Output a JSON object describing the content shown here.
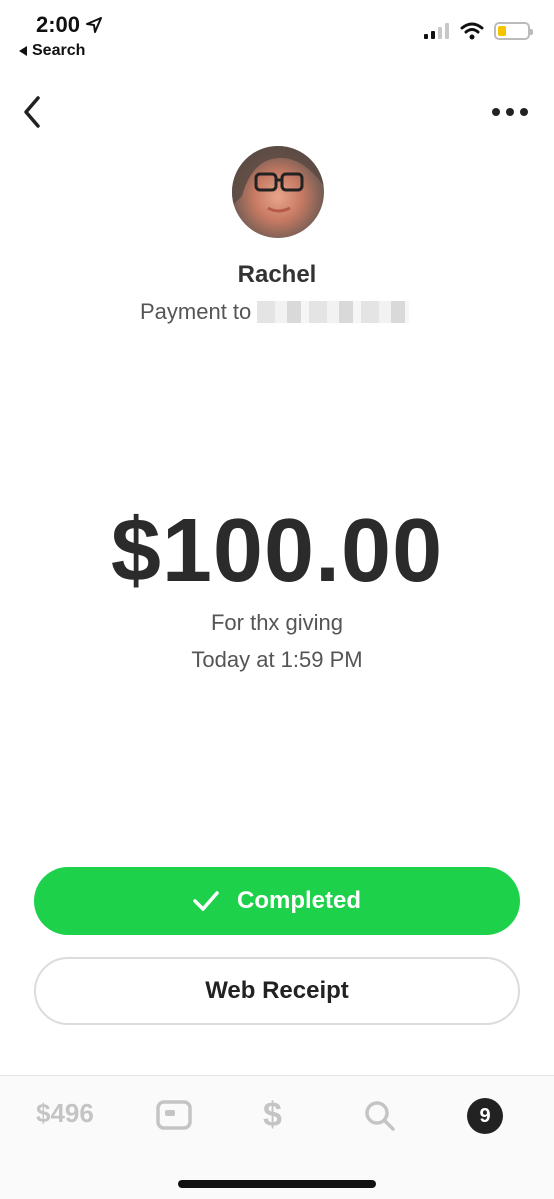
{
  "status_bar": {
    "time": "2:00",
    "back_app": "Search"
  },
  "header": {
    "back_icon": "chevron-left-icon",
    "more_icon": "more-dots-icon"
  },
  "recipient": {
    "name": "Rachel",
    "payment_label": "Payment to"
  },
  "payment": {
    "amount": "$100.00",
    "note": "For thx giving",
    "time": "Today at 1:59 PM"
  },
  "actions": {
    "completed_label": "Completed",
    "receipt_label": "Web Receipt"
  },
  "tabbar": {
    "balance": "$496",
    "activity_count": "9"
  },
  "colors": {
    "accent_green": "#1ed14b",
    "battery": "#f5c400"
  }
}
